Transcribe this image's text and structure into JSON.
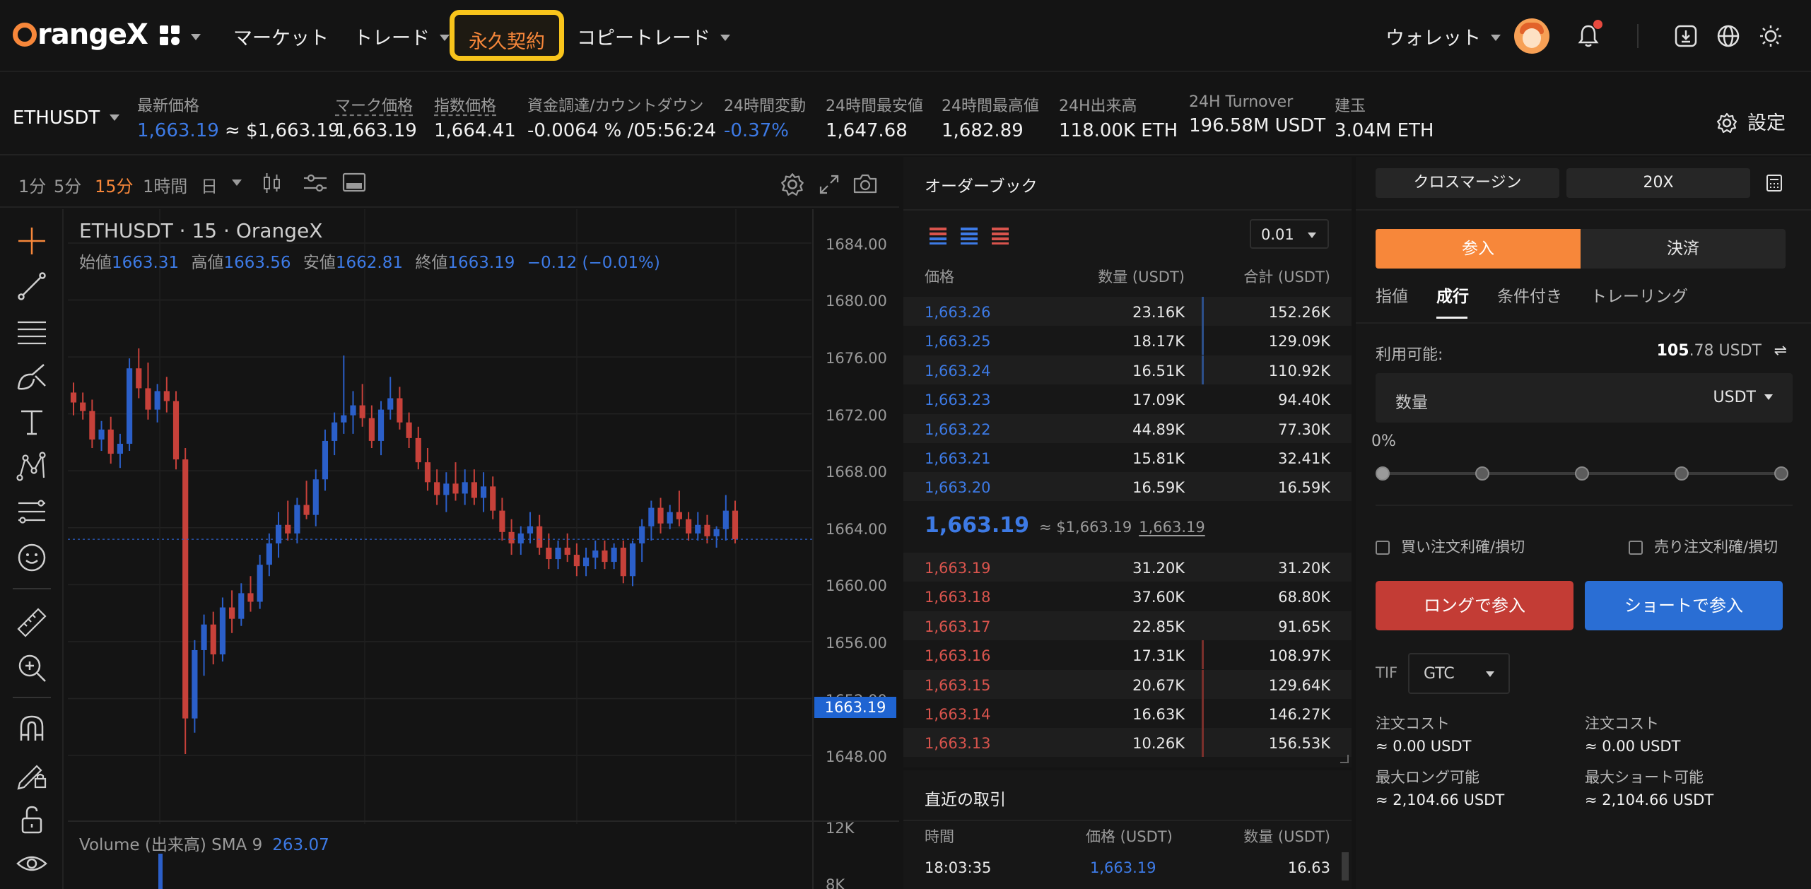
{
  "nav": {
    "logo": "rangeX",
    "items": [
      "マーケット",
      "トレード",
      "永久契約",
      "コピートレード"
    ],
    "wallet": "ウォレット"
  },
  "ticker": {
    "symbol": "ETHUSDT",
    "last_label": "最新価格",
    "last_value": "1,663.19",
    "last_usd": "≈ $1,663.19",
    "mark_label": "マーク価格",
    "mark_value": "1,663.19",
    "index_label": "指数価格",
    "index_value": "1,664.41",
    "funding_label": "資金調達/カウントダウン",
    "funding_value": "-0.0064 % /05:56:24",
    "change_label": "24時間変動",
    "change_value": "-0.37%",
    "low_label": "24時間最安値",
    "low_value": "1,647.68",
    "high_label": "24時間最高値",
    "high_value": "1,682.89",
    "vol_label": "24H出来高",
    "vol_value": "118.00K ETH",
    "turnover_label": "24H Turnover",
    "turnover_value": "196.58M USDT",
    "oi_label": "建玉",
    "oi_value": "3.04M ETH",
    "settings": "設定"
  },
  "chart": {
    "timeframes": [
      "1分",
      "5分",
      "15分",
      "1時間",
      "日"
    ],
    "active_timeframe": "15分",
    "title": "ETHUSDT · 15 · OrangeX",
    "ohlc": {
      "open_label": "始値",
      "open": "1663.31",
      "high_label": "高値",
      "high": "1663.56",
      "low_label": "安値",
      "low": "1662.81",
      "close_label": "終値",
      "close": "1663.19",
      "change": "−0.12 (−0.01%)"
    },
    "volume_label": "Volume (出来高) SMA 9",
    "volume_value": "263.07",
    "price_tag": "1663.19",
    "y_ticks": [
      "1684.00",
      "1680.00",
      "1676.00",
      "1672.00",
      "1668.00",
      "1664.00",
      "1660.00",
      "1656.00",
      "1652.00",
      "1648.00"
    ],
    "vol_ticks": [
      "12K",
      "8K"
    ]
  },
  "chart_data": {
    "type": "candlestick",
    "title": "ETHUSDT · 15 · OrangeX",
    "ylim": [
      1646,
      1687
    ],
    "up_color": "#2b5fc9",
    "down_color": "#c7413a",
    "candles": [
      [
        1673.5,
        1674.2,
        1671.9,
        1672.8
      ],
      [
        1672.8,
        1673.5,
        1671.6,
        1672.2
      ],
      [
        1672.2,
        1673.0,
        1669.6,
        1670.2
      ],
      [
        1670.2,
        1671.5,
        1669.4,
        1670.9
      ],
      [
        1670.9,
        1671.8,
        1668.5,
        1669.2
      ],
      [
        1669.2,
        1670.6,
        1668.2,
        1669.9
      ],
      [
        1669.9,
        1675.9,
        1669.4,
        1675.2
      ],
      [
        1675.2,
        1676.6,
        1673.1,
        1673.8
      ],
      [
        1673.8,
        1675.6,
        1671.6,
        1672.3
      ],
      [
        1672.3,
        1674.1,
        1671.4,
        1673.6
      ],
      [
        1673.6,
        1674.6,
        1672.1,
        1672.9
      ],
      [
        1672.9,
        1673.6,
        1668.1,
        1668.8
      ],
      [
        1668.8,
        1669.6,
        1648.1,
        1650.6
      ],
      [
        1650.6,
        1656.1,
        1649.6,
        1655.4
      ],
      [
        1655.4,
        1657.9,
        1653.6,
        1657.2
      ],
      [
        1657.2,
        1658.1,
        1654.4,
        1655.1
      ],
      [
        1655.1,
        1659.1,
        1654.6,
        1658.4
      ],
      [
        1658.4,
        1659.6,
        1656.6,
        1657.6
      ],
      [
        1657.6,
        1660.1,
        1657.1,
        1659.4
      ],
      [
        1659.4,
        1660.6,
        1658.1,
        1658.8
      ],
      [
        1658.8,
        1662.1,
        1658.3,
        1661.4
      ],
      [
        1661.4,
        1663.6,
        1660.6,
        1662.9
      ],
      [
        1662.9,
        1665.1,
        1661.9,
        1664.2
      ],
      [
        1664.2,
        1665.9,
        1663.1,
        1663.6
      ],
      [
        1663.6,
        1666.1,
        1662.9,
        1665.6
      ],
      [
        1665.6,
        1667.3,
        1664.6,
        1664.9
      ],
      [
        1664.9,
        1668.1,
        1664.1,
        1667.4
      ],
      [
        1667.4,
        1670.9,
        1666.6,
        1670.1
      ],
      [
        1670.1,
        1672.1,
        1669.1,
        1671.4
      ],
      [
        1671.4,
        1676.1,
        1670.6,
        1671.9
      ],
      [
        1671.9,
        1673.6,
        1670.6,
        1672.6
      ],
      [
        1672.6,
        1674.1,
        1671.1,
        1671.7
      ],
      [
        1671.7,
        1672.6,
        1669.6,
        1670.1
      ],
      [
        1670.1,
        1672.9,
        1669.1,
        1672.3
      ],
      [
        1672.3,
        1674.6,
        1671.6,
        1673.1
      ],
      [
        1673.1,
        1673.9,
        1670.9,
        1671.4
      ],
      [
        1671.4,
        1672.1,
        1669.6,
        1670.3
      ],
      [
        1670.3,
        1671.1,
        1668.1,
        1668.6
      ],
      [
        1668.6,
        1669.6,
        1666.6,
        1667.2
      ],
      [
        1667.2,
        1668.1,
        1665.6,
        1666.3
      ],
      [
        1666.3,
        1667.9,
        1665.1,
        1667.1
      ],
      [
        1667.1,
        1668.6,
        1665.9,
        1666.4
      ],
      [
        1666.4,
        1668.1,
        1665.6,
        1667.2
      ],
      [
        1667.2,
        1668.1,
        1665.6,
        1666.1
      ],
      [
        1666.1,
        1667.9,
        1665.1,
        1666.9
      ],
      [
        1666.9,
        1667.6,
        1664.6,
        1665.2
      ],
      [
        1665.2,
        1666.1,
        1663.1,
        1663.7
      ],
      [
        1663.7,
        1664.6,
        1662.1,
        1662.9
      ],
      [
        1662.9,
        1664.1,
        1662.1,
        1663.6
      ],
      [
        1663.6,
        1665.1,
        1662.9,
        1664.1
      ],
      [
        1664.1,
        1664.9,
        1662.1,
        1662.6
      ],
      [
        1662.6,
        1663.6,
        1661.1,
        1661.8
      ],
      [
        1661.8,
        1663.1,
        1661.1,
        1662.6
      ],
      [
        1662.6,
        1663.6,
        1661.6,
        1662.1
      ],
      [
        1662.1,
        1662.9,
        1660.6,
        1661.3
      ],
      [
        1661.3,
        1662.6,
        1660.6,
        1661.9
      ],
      [
        1661.9,
        1663.1,
        1661.1,
        1662.4
      ],
      [
        1662.4,
        1663.1,
        1661.1,
        1661.6
      ],
      [
        1661.6,
        1662.9,
        1661.1,
        1662.6
      ],
      [
        1662.6,
        1663.1,
        1660.1,
        1660.6
      ],
      [
        1660.6,
        1663.1,
        1659.9,
        1662.9
      ],
      [
        1662.9,
        1664.6,
        1661.6,
        1664.1
      ],
      [
        1664.1,
        1665.9,
        1663.1,
        1665.4
      ],
      [
        1665.4,
        1666.1,
        1663.6,
        1664.3
      ],
      [
        1664.3,
        1665.6,
        1663.9,
        1665.1
      ],
      [
        1665.1,
        1666.6,
        1664.1,
        1664.6
      ],
      [
        1664.6,
        1665.1,
        1663.1,
        1663.6
      ],
      [
        1663.6,
        1665.1,
        1663.1,
        1664.2
      ],
      [
        1664.2,
        1664.9,
        1662.9,
        1663.4
      ],
      [
        1663.4,
        1664.1,
        1662.6,
        1663.9
      ],
      [
        1663.9,
        1666.3,
        1663.1,
        1665.2
      ],
      [
        1665.2,
        1665.9,
        1662.9,
        1663.19
      ]
    ]
  },
  "orderbook": {
    "title": "オーダーブック",
    "step": "0.01",
    "headers": [
      "価格",
      "数量 (USDT)",
      "合計 (USDT)"
    ],
    "asks": [
      [
        "1,663.26",
        "23.16K",
        "152.26K"
      ],
      [
        "1,663.25",
        "18.17K",
        "129.09K"
      ],
      [
        "1,663.24",
        "16.51K",
        "110.92K"
      ],
      [
        "1,663.23",
        "17.09K",
        "94.40K"
      ],
      [
        "1,663.22",
        "44.89K",
        "77.30K"
      ],
      [
        "1,663.21",
        "15.81K",
        "32.41K"
      ],
      [
        "1,663.20",
        "16.59K",
        "16.59K"
      ]
    ],
    "mid_price": "1,663.19",
    "mid_usd": "≈ $1,663.19",
    "mid_mark": "1,663.19",
    "bids": [
      [
        "1,663.19",
        "31.20K",
        "31.20K"
      ],
      [
        "1,663.18",
        "37.60K",
        "68.80K"
      ],
      [
        "1,663.17",
        "22.85K",
        "91.65K"
      ],
      [
        "1,663.16",
        "17.31K",
        "108.97K"
      ],
      [
        "1,663.15",
        "20.67K",
        "129.64K"
      ],
      [
        "1,663.14",
        "16.63K",
        "146.27K"
      ],
      [
        "1,663.13",
        "10.26K",
        "156.53K"
      ]
    ]
  },
  "trades": {
    "title": "直近の取引",
    "headers": [
      "時間",
      "価格 (USDT)",
      "数量 (USDT)"
    ],
    "rows": [
      [
        "18:03:35",
        "1,663.19",
        "16.63"
      ]
    ]
  },
  "form": {
    "margin_mode": "クロスマージン",
    "leverage": "20X",
    "open": "参入",
    "close": "決済",
    "tabs": [
      "指値",
      "成行",
      "条件付き",
      "トレーリング"
    ],
    "active_tab": "成行",
    "available_label": "利用可能:",
    "available_int": "105",
    "available_rest": ".78 USDT",
    "qty_label": "数量",
    "qty_unit": "USDT",
    "percent": "0%",
    "tp_buy": "買い注文利確/損切",
    "tp_sell": "売り注文利確/損切",
    "long_btn": "ロングで参入",
    "short_btn": "ショートで参入",
    "tif_label": "TIF",
    "tif_value": "GTC",
    "cost_label": "注文コスト",
    "cost_long": "≈ 0.00 USDT",
    "cost_short": "≈ 0.00 USDT",
    "max_long_label": "最大ロング可能",
    "max_long": "≈ 2,104.66 USDT",
    "max_short_label": "最大ショート可能",
    "max_short": "≈ 2,104.66 USDT"
  },
  "colors": {
    "accent": "#f7873a",
    "highlight": "#f9c51b",
    "up": "#3d7ae5",
    "down": "#d9544d"
  }
}
